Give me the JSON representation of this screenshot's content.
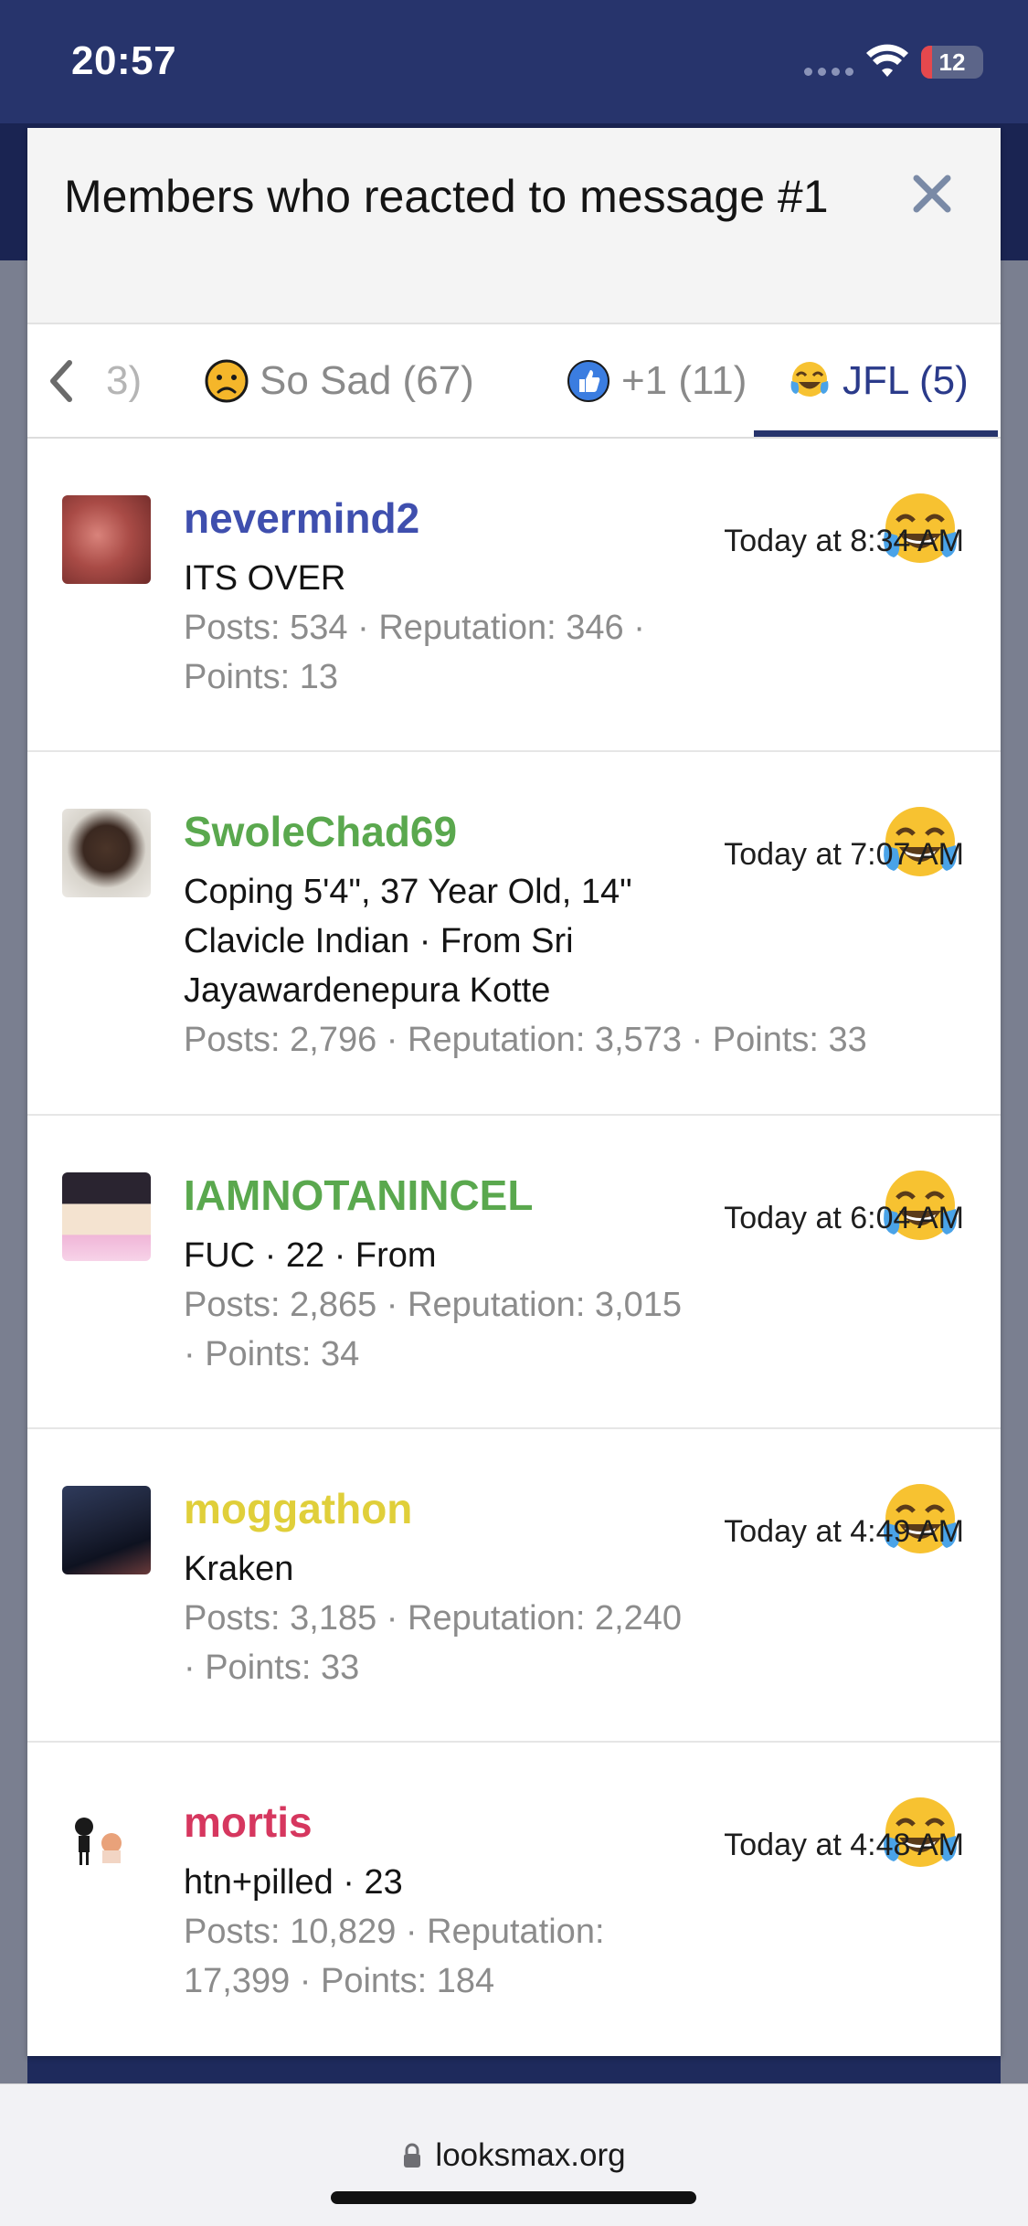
{
  "status_bar": {
    "time": "20:57",
    "battery": "12"
  },
  "modal": {
    "title": "Members who reacted to message #1",
    "close_icon": "close-x-icon"
  },
  "tabs": {
    "prev_icon": "chevron-left-icon",
    "items": [
      {
        "label": "3)",
        "icon": null,
        "active": false
      },
      {
        "label": "So Sad (67)",
        "icon": "sad-face-emoji",
        "active": false
      },
      {
        "label": "+1 (11)",
        "icon": "thumbs-up-icon",
        "active": false
      },
      {
        "label": "JFL (5)",
        "icon": "tears-of-joy-emoji",
        "active": true
      }
    ]
  },
  "members": [
    {
      "username": "nevermind2",
      "name_color": "#3f4fae",
      "title_line1": "ITS OVER",
      "title_line2": "",
      "title_line3": "",
      "stats_line1": "Posts: 534 · Reputation: 346 ·",
      "stats_line2": "Points: 13",
      "time": "Today at 8:34 AM",
      "reaction": "tears-of-joy-emoji"
    },
    {
      "username": "SwoleChad69",
      "name_color": "#5aa84e",
      "title_line1": "Coping 5'4\", 37 Year Old, 14\"",
      "title_line2": "Clavicle Indian · From Sri",
      "title_line3": "Jayawardenepura Kotte",
      "stats_line1": "Posts: 2,796 · Reputation: 3,573 · Points: 33",
      "stats_line2": "",
      "time": "Today at 7:07 AM",
      "reaction": "tears-of-joy-emoji"
    },
    {
      "username": "IAMNOTANINCEL",
      "name_color": "#5aa84e",
      "title_line1": "FUC · 22 · From",
      "title_line2": "",
      "title_line3": "",
      "stats_line1": "Posts: 2,865 · Reputation: 3,015",
      "stats_line2": "· Points: 34",
      "time": "Today at 6:04 AM",
      "reaction": "tears-of-joy-emoji"
    },
    {
      "username": "moggathon",
      "name_color": "#e0cf3a",
      "title_line1": "Kraken",
      "title_line2": "",
      "title_line3": "",
      "stats_line1": "Posts: 3,185 · Reputation: 2,240",
      "stats_line2": "· Points: 33",
      "time": "Today at 4:49 AM",
      "reaction": "tears-of-joy-emoji"
    },
    {
      "username": "mortis",
      "name_color": "#d6375f",
      "title_line1": "htn+pilled · 23",
      "title_line2": "",
      "title_line3": "",
      "stats_line1": "Posts: 10,829 · Reputation:",
      "stats_line2": "17,399 · Points: 184",
      "time": "Today at 4:48 AM",
      "reaction": "tears-of-joy-emoji"
    }
  ],
  "browser": {
    "url": "looksmax.org",
    "lock_icon": "lock-icon"
  }
}
